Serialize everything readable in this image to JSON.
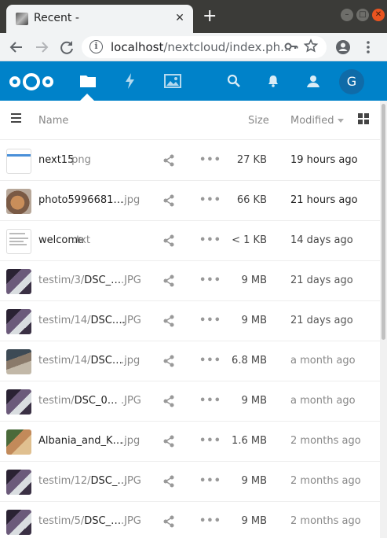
{
  "browser": {
    "tab_title": "Recent -",
    "close_tab_glyph": "✕",
    "new_tab_glyph": "+",
    "url_host": "localhost",
    "url_rest": "/nextcloud/index.ph...",
    "icons": [
      "back-icon",
      "forward-icon",
      "reload-icon",
      "info-icon",
      "key-icon",
      "star-icon",
      "account-icon",
      "menu-icon"
    ]
  },
  "app": {
    "name": "Nextcloud",
    "accent": "#0082c9",
    "apps": [
      "files",
      "activity",
      "gallery"
    ],
    "header_right": [
      "search",
      "notifications",
      "contacts"
    ],
    "avatar_initial": "G"
  },
  "list": {
    "columns": {
      "name": "Name",
      "size": "Size",
      "modified": "Modified"
    },
    "rows": [
      {
        "path": "",
        "name": "next15",
        "ext": ".png",
        "size": "27 KB",
        "modified": "19 hours ago",
        "modified_color": "#222",
        "thumb": "screenshot"
      },
      {
        "path": "",
        "name": "photo5996681…",
        "ext": ".jpg",
        "size": "66 KB",
        "modified": "21 hours ago",
        "modified_color": "#222",
        "thumb": "photo-dog"
      },
      {
        "path": "",
        "name": "welcome",
        "ext": ".txt",
        "size": "< 1 KB",
        "modified": "14 days ago",
        "modified_color": "#444",
        "thumb": "text"
      },
      {
        "path": "testim/3/",
        "name": "DSC_…",
        "ext": ".JPG",
        "size": "9 MB",
        "modified": "21 days ago",
        "modified_color": "#555",
        "thumb": "photo-room"
      },
      {
        "path": "testim/14/",
        "name": "DSC.…",
        "ext": ".JPG",
        "size": "9 MB",
        "modified": "21 days ago",
        "modified_color": "#555",
        "thumb": "photo-room"
      },
      {
        "path": "testim/14/",
        "name": "DSC…",
        "ext": ".jpg",
        "size": "6.8 MB",
        "modified": "a month ago",
        "modified_color": "#888",
        "thumb": "photo-group"
      },
      {
        "path": "testim/",
        "name": "DSC_0…",
        "ext": ".JPG",
        "size": "9 MB",
        "modified": "a month ago",
        "modified_color": "#888",
        "thumb": "photo-room"
      },
      {
        "path": "",
        "name": "Albania_and_K…",
        "ext": ".jpg",
        "size": "1.6 MB",
        "modified": "2 months ago",
        "modified_color": "#888",
        "thumb": "photo-people"
      },
      {
        "path": "testim/12/",
        "name": "DSC_…",
        "ext": ".JPG",
        "size": "9 MB",
        "modified": "2 months ago",
        "modified_color": "#888",
        "thumb": "photo-room"
      },
      {
        "path": "testim/5/",
        "name": "DSC_…",
        "ext": ".JPG",
        "size": "9 MB",
        "modified": "2 months ago",
        "modified_color": "#888",
        "thumb": "photo-room"
      }
    ]
  }
}
